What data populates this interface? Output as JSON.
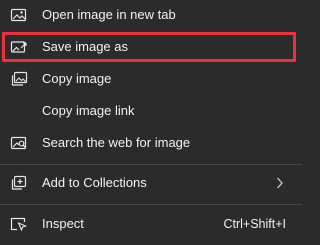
{
  "menu": {
    "items": [
      {
        "label": "Open image in new tab",
        "icon": "image-new-tab-icon"
      },
      {
        "label": "Save image as",
        "icon": "save-image-icon"
      },
      {
        "label": "Copy image",
        "icon": "copy-image-icon"
      },
      {
        "label": "Copy image link",
        "icon": ""
      },
      {
        "label": "Search the web for image",
        "icon": "visual-search-icon"
      },
      {
        "label": "Add to Collections",
        "icon": "collections-icon"
      },
      {
        "label": "Inspect",
        "icon": "inspect-icon",
        "shortcut": "Ctrl+Shift+I"
      }
    ]
  },
  "colors": {
    "background": "#2b2b2b",
    "text": "#f2f2f2",
    "highlight_border": "#e8333e",
    "separator": "#4a4a4a"
  }
}
